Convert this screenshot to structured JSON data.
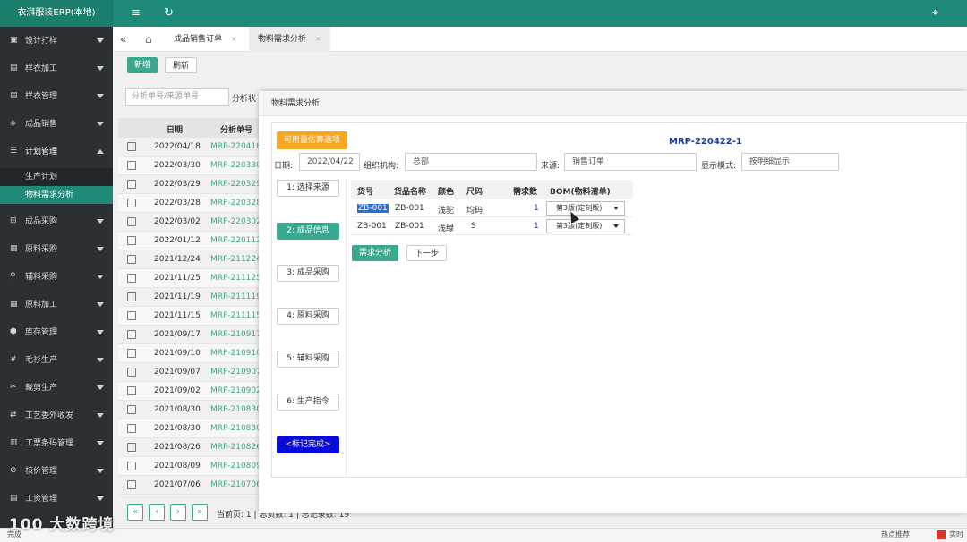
{
  "app": {
    "title": "衣湃服装ERP(本地)",
    "menu_icon": "≡",
    "refresh_icon": "↻",
    "tag_icon": "⌖"
  },
  "sidebar": {
    "items": [
      {
        "label": "设计打样",
        "icon": "▣"
      },
      {
        "label": "样衣加工",
        "icon": "▤"
      },
      {
        "label": "样衣管理",
        "icon": "▤"
      },
      {
        "label": "成品销售",
        "icon": "◈"
      },
      {
        "label": "计划管理",
        "icon": "☰"
      },
      {
        "label": "成品采购",
        "icon": "⊞"
      },
      {
        "label": "原料采购",
        "icon": "▦"
      },
      {
        "label": "辅料采购",
        "icon": "⚲"
      },
      {
        "label": "原料加工",
        "icon": "▦"
      },
      {
        "label": "库存管理",
        "icon": "⬢"
      },
      {
        "label": "毛衫生产",
        "icon": "#"
      },
      {
        "label": "裁剪生产",
        "icon": "✂"
      },
      {
        "label": "工艺委外收发",
        "icon": "⇄"
      },
      {
        "label": "工票条码管理",
        "icon": "▥"
      },
      {
        "label": "核价管理",
        "icon": "⊘"
      },
      {
        "label": "工资管理",
        "icon": "▤"
      }
    ],
    "submenu": [
      "生产计划",
      "物料需求分析"
    ]
  },
  "tabs": {
    "collapse_icon": "«",
    "home_icon": "⌂",
    "items": [
      "成品销售订单",
      "物料需求分析"
    ],
    "close": "×"
  },
  "toolbar": {
    "add": "新增",
    "refresh": "刷新"
  },
  "search": {
    "placeholder": "分析单号/来源单号",
    "status_label": "分析状"
  },
  "grid": {
    "headers": [
      "日期",
      "分析单号"
    ],
    "rows": [
      {
        "date": "2022/04/18",
        "no": "MRP-220418-"
      },
      {
        "date": "2022/03/30",
        "no": "MRP-220330-"
      },
      {
        "date": "2022/03/29",
        "no": "MRP-220329-"
      },
      {
        "date": "2022/03/28",
        "no": "MRP-220328-"
      },
      {
        "date": "2022/03/02",
        "no": "MRP-220302-"
      },
      {
        "date": "2022/01/12",
        "no": "MRP-220112-"
      },
      {
        "date": "2021/12/24",
        "no": "MRP-211224-"
      },
      {
        "date": "2021/11/25",
        "no": "MRP-211125-"
      },
      {
        "date": "2021/11/19",
        "no": "MRP-211119-"
      },
      {
        "date": "2021/11/15",
        "no": "MRP-211115-"
      },
      {
        "date": "2021/09/17",
        "no": "MRP-210917-"
      },
      {
        "date": "2021/09/10",
        "no": "MRP-210910-"
      },
      {
        "date": "2021/09/07",
        "no": "MRP-210907-"
      },
      {
        "date": "2021/09/02",
        "no": "MRP-210902-"
      },
      {
        "date": "2021/08/30",
        "no": "MRP-210830-"
      },
      {
        "date": "2021/08/30",
        "no": "MRP-210830-"
      },
      {
        "date": "2021/08/26",
        "no": "MRP-210826-"
      },
      {
        "date": "2021/08/09",
        "no": "MRP-210809-"
      },
      {
        "date": "2021/07/06",
        "no": "MRP-210706-"
      }
    ],
    "pager": {
      "first": "«",
      "prev": "‹",
      "next": "›",
      "last": "»",
      "text": "当前页: 1 | 总页数: 1 | 总记录数: 19"
    }
  },
  "modal": {
    "title": "物料需求分析",
    "budget_button": "可用量估算选项",
    "mrp_no": "MRP-220422-1",
    "fields": {
      "date_label": "日期:",
      "date_value": "2022/04/22",
      "org_label": "组织机构:",
      "org_value": "总部",
      "source_label": "来源:",
      "source_value": "销售订单",
      "mode_label": "显示模式:",
      "mode_value": "按明细显示"
    },
    "steps": [
      "1: 选择来源",
      "2: 成品信息",
      "3: 成品采购",
      "4: 原料采购",
      "5: 辅料采购",
      "6: 生产指令",
      "<标记完成>"
    ],
    "table": {
      "headers": [
        "货号",
        "货品名称",
        "颜色",
        "尺码",
        "需求数",
        "BOM(物料清单)"
      ],
      "rows": [
        {
          "code": "ZB-001",
          "name": "ZB-001",
          "color": "浅驼",
          "size": "均码",
          "qty": "1",
          "bom": "第3版(定制版)"
        },
        {
          "code": "ZB-001",
          "name": "ZB-001",
          "color": "浅绿",
          "size": "S",
          "qty": "1",
          "bom": "第3版(定制版)"
        }
      ]
    },
    "analyze_button": "需求分析",
    "next_button": "下一步"
  },
  "statusbar": {
    "left": "完成",
    "hot": "热点推荐",
    "right": "实时"
  },
  "watermark": "100 大数跨境"
}
